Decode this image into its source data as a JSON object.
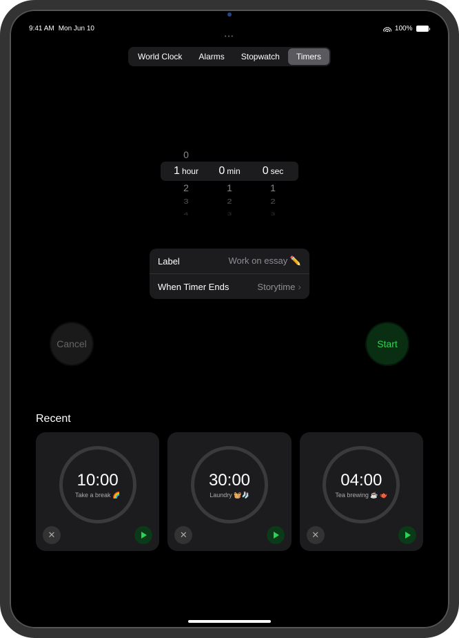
{
  "status": {
    "time": "9:41 AM",
    "date": "Mon Jun 10",
    "battery_pct": "100%"
  },
  "tabs": {
    "world_clock": "World Clock",
    "alarms": "Alarms",
    "stopwatch": "Stopwatch",
    "timers": "Timers"
  },
  "picker": {
    "above_hour": "0",
    "hour_val": "1",
    "hour_unit": "hour",
    "min_val": "0",
    "min_unit": "min",
    "sec_val": "0",
    "sec_unit": "sec",
    "below": [
      {
        "h": "2",
        "m": "1",
        "s": "1"
      },
      {
        "h": "3",
        "m": "2",
        "s": "2"
      },
      {
        "h": "4",
        "m": "3",
        "s": "3"
      }
    ]
  },
  "settings": {
    "label_key": "Label",
    "label_val": "Work on essay ✏️",
    "ends_key": "When Timer Ends",
    "ends_val": "Storytime"
  },
  "buttons": {
    "cancel": "Cancel",
    "start": "Start"
  },
  "recent": {
    "title": "Recent",
    "items": [
      {
        "time": "10:00",
        "label": "Take a break 🌈"
      },
      {
        "time": "30:00",
        "label": "Laundry 🧺🧦"
      },
      {
        "time": "04:00",
        "label": "Tea brewing ☕️ 🫖"
      }
    ]
  }
}
